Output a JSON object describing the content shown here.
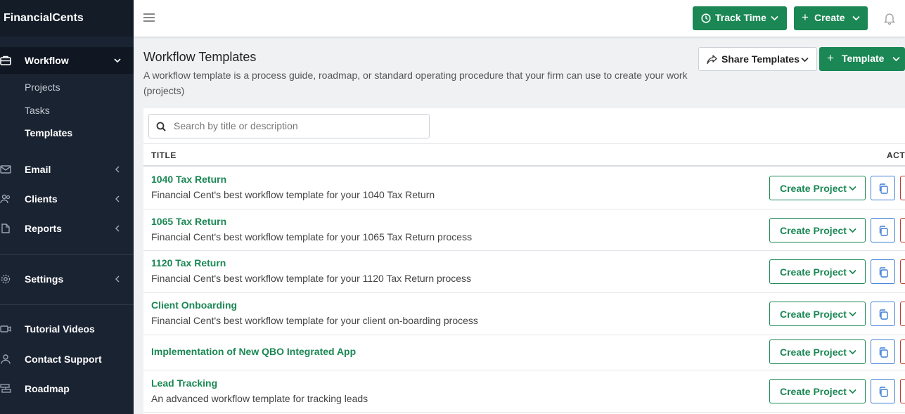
{
  "app": {
    "brand": "FinancialCents"
  },
  "sidebar": {
    "workflow": "Workflow",
    "workflow_children": [
      "Projects",
      "Tasks",
      "Templates"
    ],
    "email": "Email",
    "clients": "Clients",
    "reports": "Reports",
    "settings": "Settings",
    "tutorial_videos": "Tutorial Videos",
    "contact_support": "Contact Support",
    "roadmap": "Roadmap"
  },
  "topbar": {
    "track_time": "Track Time",
    "create": "Create"
  },
  "page": {
    "title": "Workflow Templates",
    "description": "A workflow template is a process guide, roadmap, or standard operating procedure that your firm can use to create your work (projects)",
    "share_templates": "Share Templates",
    "template_button": "Template"
  },
  "search": {
    "placeholder": "Search by title or description",
    "value": ""
  },
  "table": {
    "col_title": "TITLE",
    "col_actions": "ACTI",
    "action_label": "Create Project",
    "rows": [
      {
        "title": "1040 Tax Return",
        "description": "Financial Cent's best workflow template for your 1040 Tax Return"
      },
      {
        "title": "1065 Tax Return",
        "description": "Financial Cent's best workflow template for your 1065 Tax Return process"
      },
      {
        "title": "1120 Tax Return",
        "description": "Financial Cent's best workflow template for your 1120 Tax Return process"
      },
      {
        "title": "Client Onboarding",
        "description": "Financial Cent's best workflow template for your client on-boarding process"
      },
      {
        "title": "Implementation of New QBO Integrated App",
        "description": ""
      },
      {
        "title": "Lead Tracking",
        "description": "An advanced workflow template for tracking leads"
      }
    ]
  },
  "icons": {
    "workflow": "briefcase-icon",
    "email": "envelope-icon",
    "clients": "users-icon",
    "reports": "file-icon",
    "settings": "gear-icon",
    "tutorial": "video-icon",
    "support": "user-icon",
    "roadmap": "signpost-icon",
    "menu": "hamburger-icon",
    "bell": "bell-icon",
    "search": "search-icon",
    "copy": "copy-icon",
    "share": "share-icon"
  },
  "colors": {
    "sidebar": "#1a2332",
    "accent": "#1a8754",
    "copy": "#3d7fd6",
    "delete": "#c0392b"
  }
}
